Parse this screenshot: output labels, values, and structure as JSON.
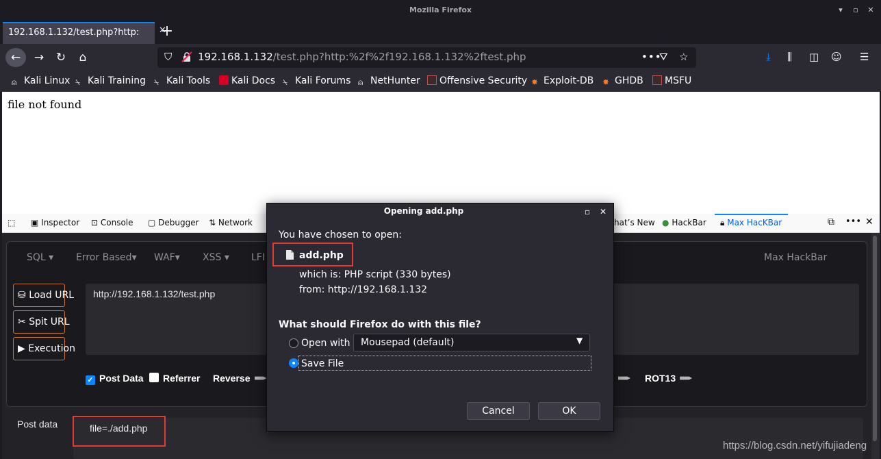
{
  "window": {
    "title": "Mozilla Firefox"
  },
  "tab": {
    "title": "192.168.1.132/test.php?http:"
  },
  "urlbar": {
    "host": "192.168.1.132",
    "path": "/test.php?http:%2f%2f192.168.1.132%2ftest.php"
  },
  "bookmarks": [
    "Kali Linux",
    "Kali Training",
    "Kali Tools",
    "Kali Docs",
    "Kali Forums",
    "NetHunter",
    "Offensive Security",
    "Exploit-DB",
    "GHDB",
    "MSFU"
  ],
  "page": {
    "text": "file not found"
  },
  "devtools": {
    "tabs": [
      "Inspector",
      "Console",
      "Debugger",
      "Network"
    ],
    "right_tabs": [
      "hat’s New",
      "HackBar",
      "Max HacKBar"
    ]
  },
  "hackbar": {
    "menus": [
      "SQL",
      "Error Based",
      "WAF",
      "XSS",
      "LFI"
    ],
    "brand": "Max HackBar",
    "buttons": [
      "Load URL",
      "Spit URL",
      "Execution"
    ],
    "url_value": "http://192.168.1.132/test.php",
    "options": [
      "Post Data",
      "Referrer",
      "Reverse",
      "ROT13"
    ],
    "post_label": "Post data",
    "post_value": "file=./add.php"
  },
  "dialog": {
    "title": "Opening add.php",
    "intro": "You have chosen to open:",
    "filename": "add.php",
    "which_is_label": "which is:",
    "which_is_value": "PHP script (330 bytes)",
    "from_label": "from:",
    "from_value": "http://192.168.1.132",
    "question": "What should Firefox do with this file?",
    "open_with_label": "Open with",
    "open_with_app": "Mousepad (default)",
    "save_label": "Save File",
    "cancel_label": "Cancel",
    "ok_label": "OK"
  },
  "watermark": "https://blog.csdn.net/yifujiadeng",
  "colors": {
    "accent": "#0a84ff",
    "highlight_red": "#e53935",
    "hackbar_border": "#c87432"
  }
}
